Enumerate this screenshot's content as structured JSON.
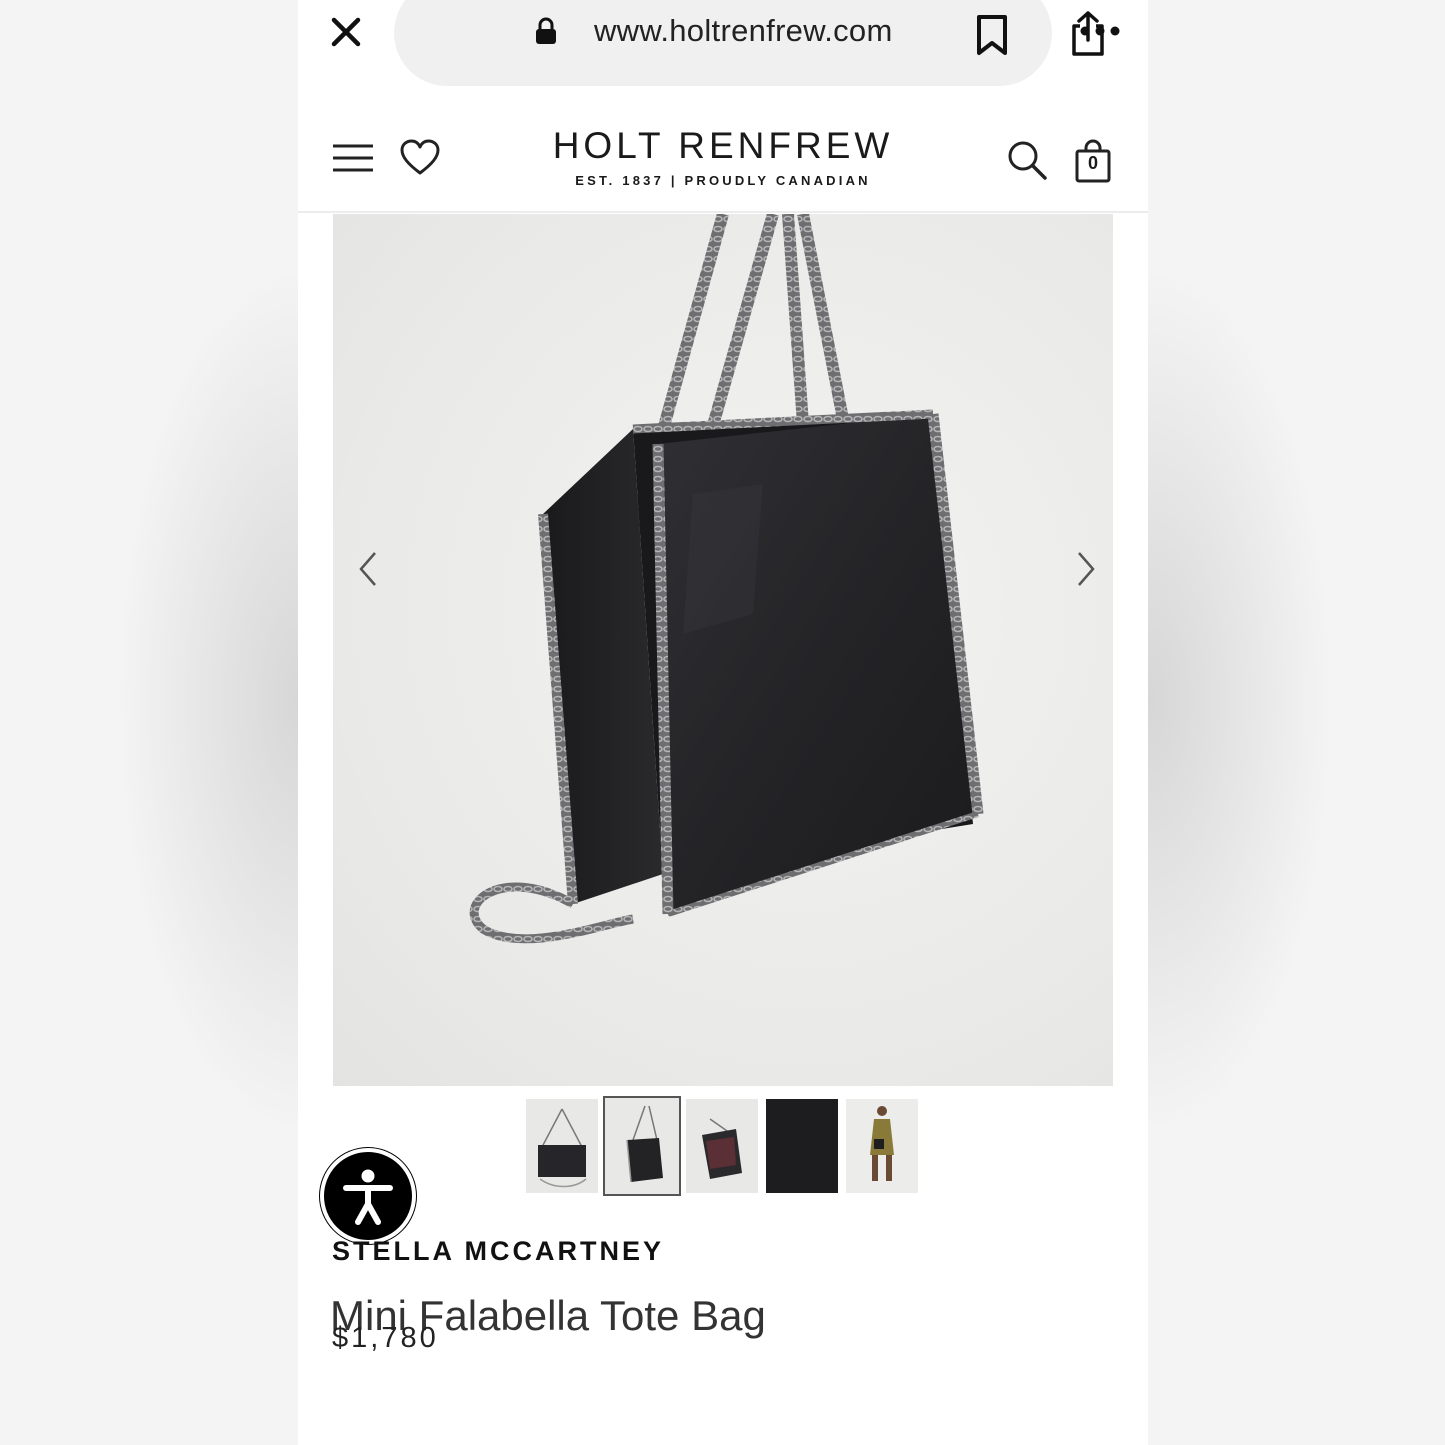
{
  "browser": {
    "url": "www.holtrenfrew.com"
  },
  "header": {
    "logo_main": "HOLT RENFREW",
    "logo_sub": "EST. 1837 | PROUDLY CANADIAN",
    "bag_count": "0"
  },
  "product": {
    "brand": "STELLA MCCARTNEY",
    "name": "Mini Falabella Tote Bag",
    "price": "$1,780",
    "thumbnail_count": 5,
    "active_thumbnail": 2
  },
  "colors": {
    "accent": "#111111",
    "image_bg": "#e9e9e7",
    "bag": "#232326",
    "chain": "#8c8c8e"
  },
  "icons": [
    "close-icon",
    "lock-icon",
    "bookmark-icon",
    "share-icon",
    "more-icon",
    "menu-icon",
    "heart-icon",
    "search-icon",
    "bag-icon",
    "chevron-left-icon",
    "chevron-right-icon",
    "accessibility-icon"
  ]
}
